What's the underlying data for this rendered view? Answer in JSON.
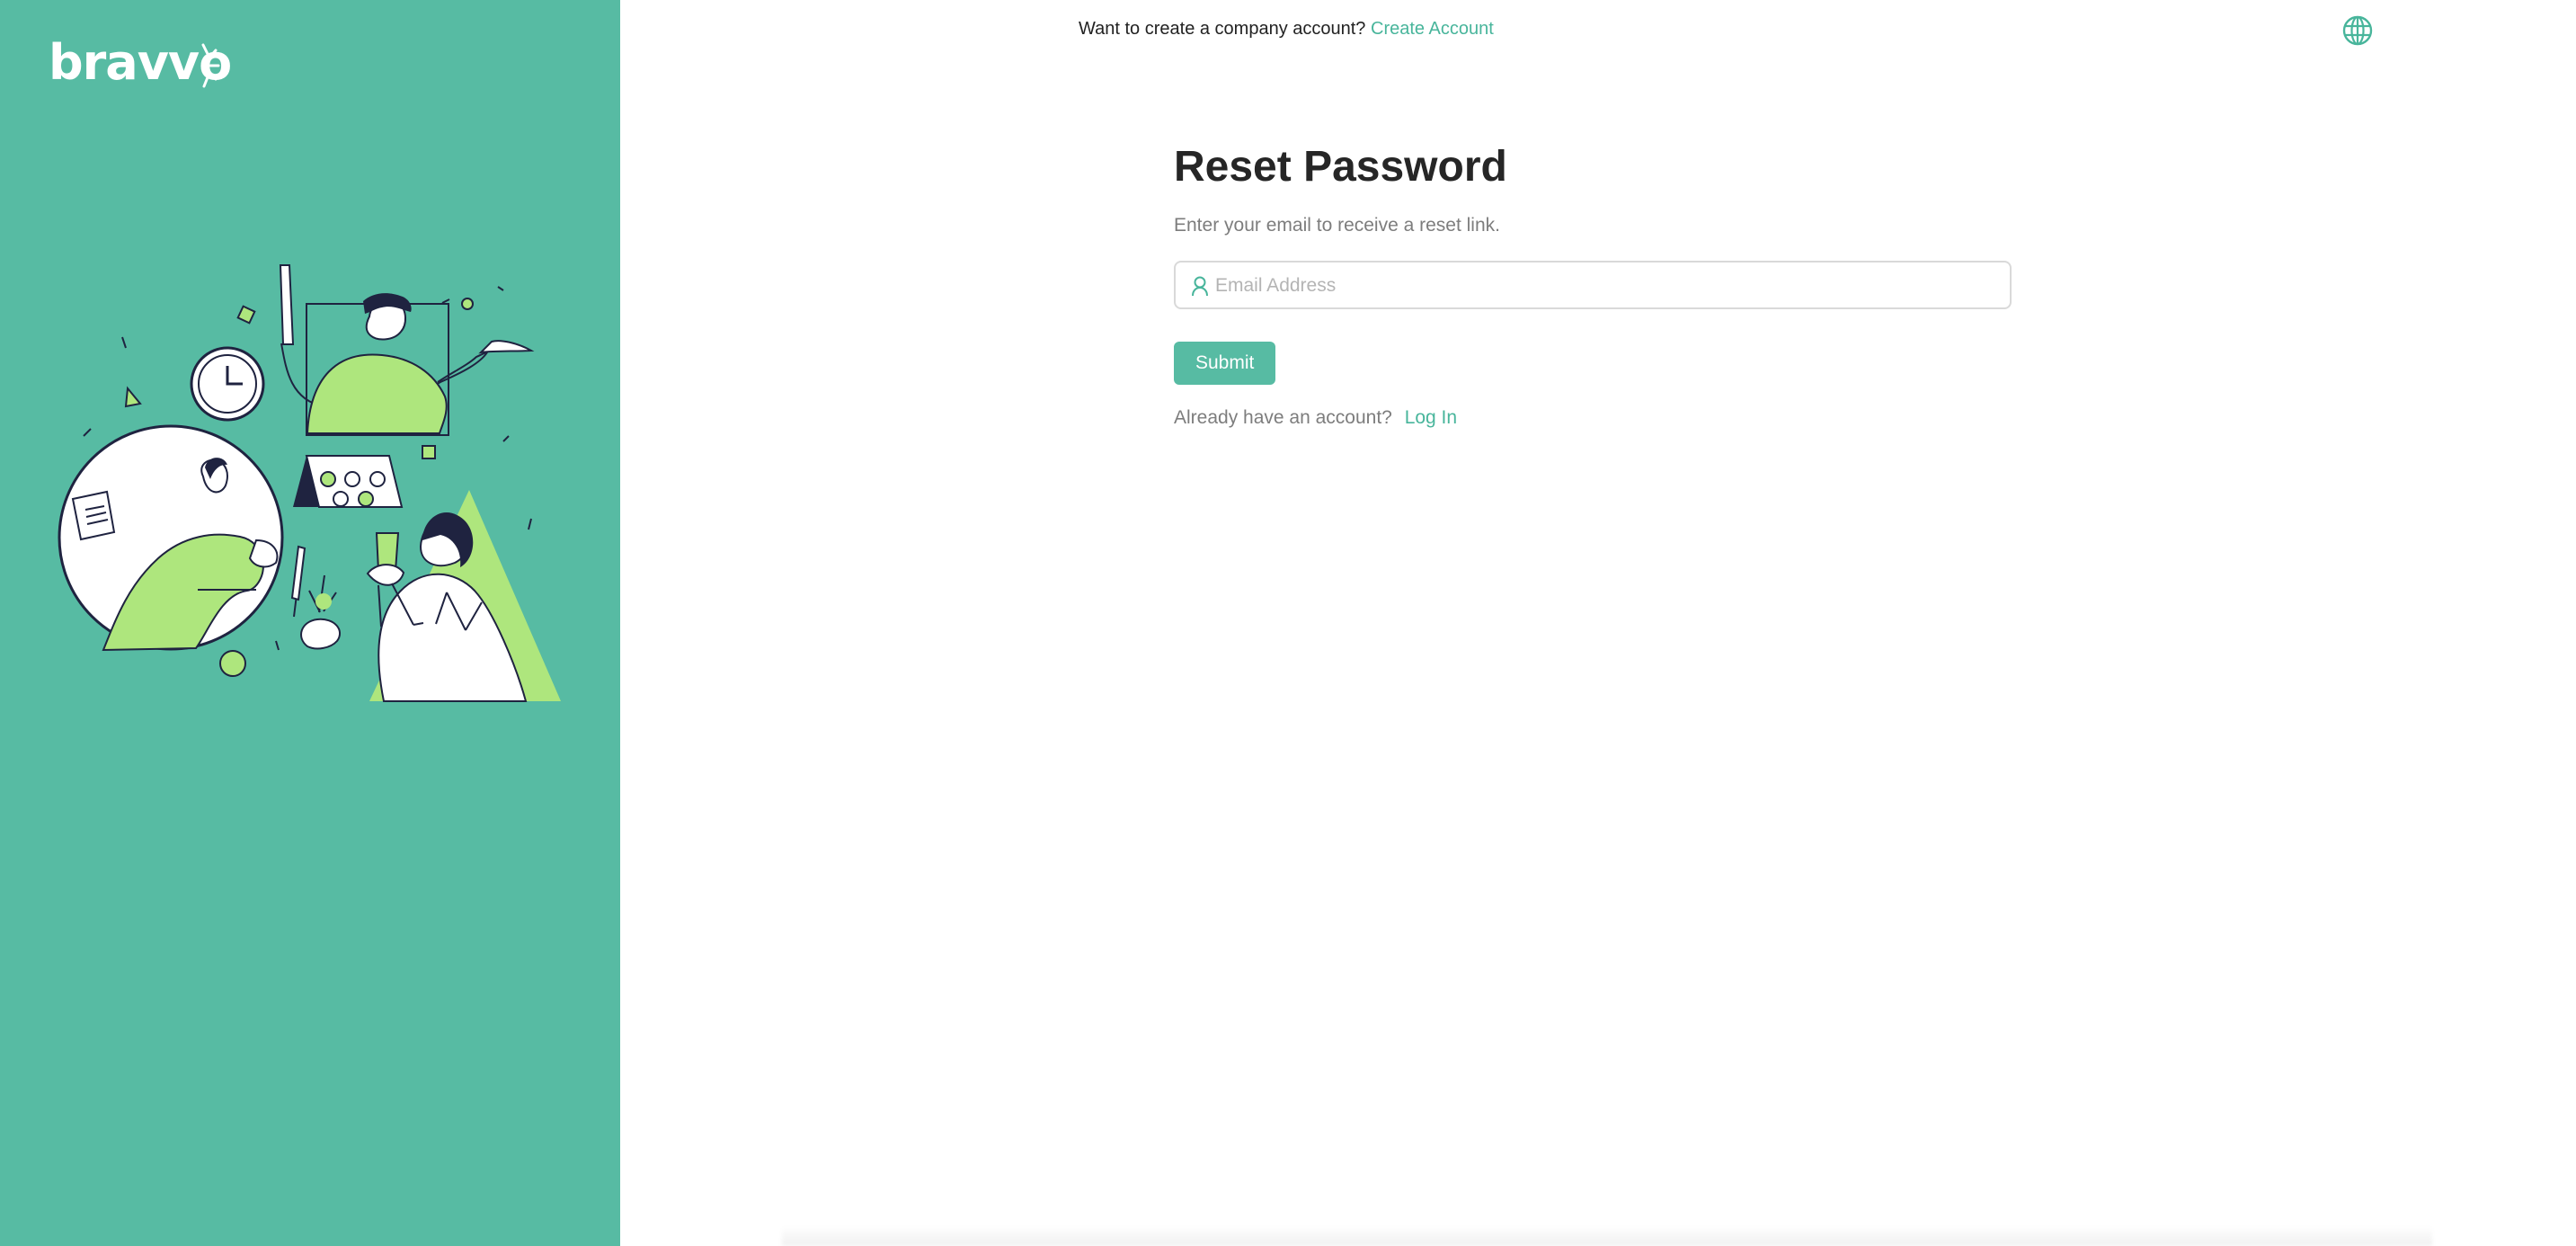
{
  "brand": {
    "logo_text": "bravvo",
    "accent_color": "#57bba3",
    "link_color": "#48b59b"
  },
  "header": {
    "prompt_text": "Want to create a company account?",
    "create_account_label": "Create Account",
    "language_icon": "globe-icon"
  },
  "form": {
    "title": "Reset Password",
    "subtitle": "Enter your email to receive a reset link.",
    "email_placeholder": "Email Address",
    "email_value": "",
    "email_icon": "user-icon",
    "submit_label": "Submit",
    "login_prompt": "Already have an account?",
    "login_label": "Log In"
  },
  "illustration": {
    "icon": "team-collaboration-illustration"
  }
}
